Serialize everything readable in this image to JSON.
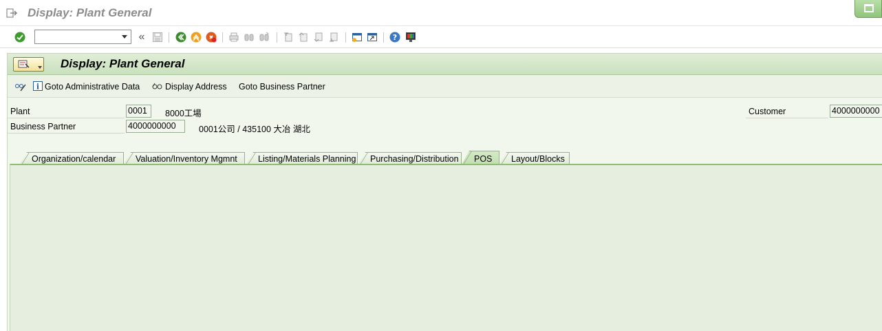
{
  "window": {
    "title": "Display: Plant General"
  },
  "toolbar": {
    "command_value": "",
    "back_label": "«",
    "icons": [
      "enter-icon",
      "save-icon",
      "back-icon",
      "exit-icon",
      "cancel-icon",
      "print-icon",
      "find-icon",
      "find-next-icon",
      "first-page-icon",
      "prev-page-icon",
      "next-page-icon",
      "last-page-icon",
      "new-session-icon",
      "shortcut-icon",
      "help-icon",
      "customize-layout-icon"
    ]
  },
  "screen": {
    "title": "Display: Plant General"
  },
  "app_toolbar": {
    "goto_admin": "Goto Administrative Data",
    "display_address": "Display Address",
    "goto_business_partner": "Goto Business Partner"
  },
  "form": {
    "plant_label": "Plant",
    "plant_value": "0001",
    "plant_desc": "8000工場",
    "bp_label": "Business Partner",
    "bp_value": "4000000000",
    "bp_desc": "0001公司 / 435100 大冶 湖北",
    "customer_label": "Customer",
    "customer_value": "4000000000"
  },
  "tabs": [
    {
      "label": "Organization/calendar"
    },
    {
      "label": "Valuation/Inventory Mgmnt"
    },
    {
      "label": "Listing/Materials Planning"
    },
    {
      "label": "Purchasing/Distribution"
    },
    {
      "label": "POS"
    },
    {
      "label": "Layout/Blocks"
    }
  ],
  "active_tab": "POS",
  "colors": {
    "accent_green": "#8fbd74",
    "screen_bg": "#f2f7ee"
  }
}
